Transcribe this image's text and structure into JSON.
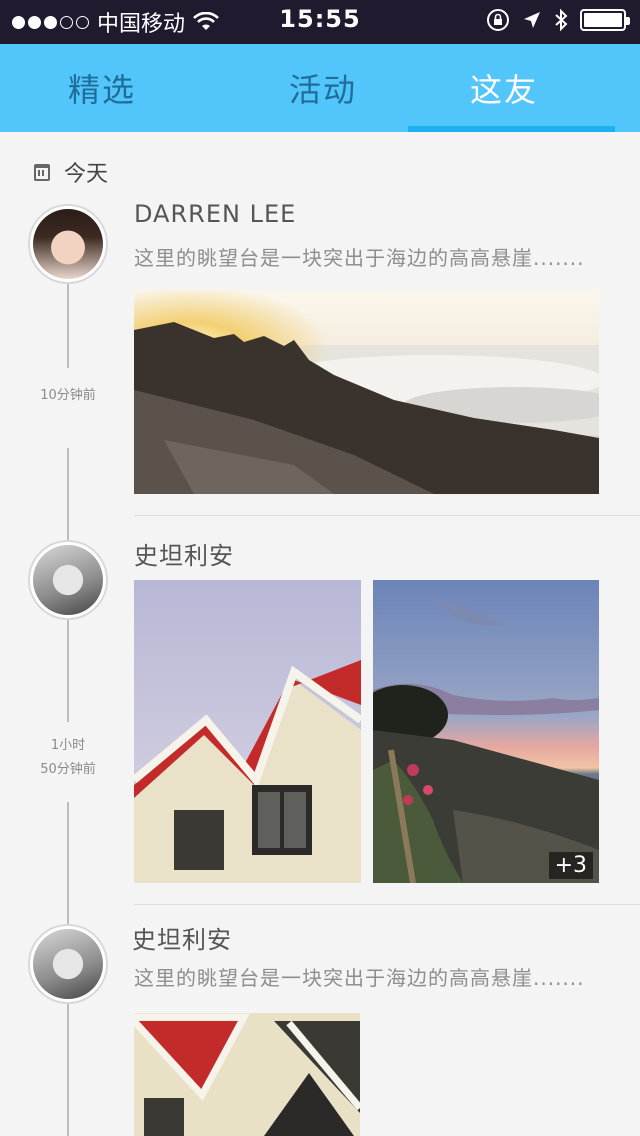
{
  "status_bar": {
    "carrier": "中国移动",
    "time": "15:55"
  },
  "tabs": [
    {
      "label": "精选",
      "active": false
    },
    {
      "label": "活动",
      "active": false
    },
    {
      "label": "这友",
      "active": true
    }
  ],
  "day_label": "今天",
  "posts": [
    {
      "username": "DARREN LEE",
      "description": "这里的眺望台是一块突出于海边的高高悬崖.......",
      "time": "10分钟前",
      "images": [
        "sunrise-over-clouds-mountain-photo"
      ]
    },
    {
      "username": "史坦利安",
      "time_line1": "1小时",
      "time_line2": "50分钟前",
      "images": [
        "red-roof-house-photo",
        "seaside-sunset-photo"
      ],
      "more_count": "+3"
    },
    {
      "username": "史坦利安",
      "description": "这里的眺望台是一块突出于海边的高高悬崖.......",
      "images": [
        "red-roof-house-photo"
      ]
    }
  ],
  "colors": {
    "status_bar_bg": "#1f1a2e",
    "tab_bar_bg": "#52c5fa",
    "tab_indicator": "#1db0f2",
    "tab_inactive_text": "#1f6e9a",
    "page_bg": "#f4f4f4"
  }
}
